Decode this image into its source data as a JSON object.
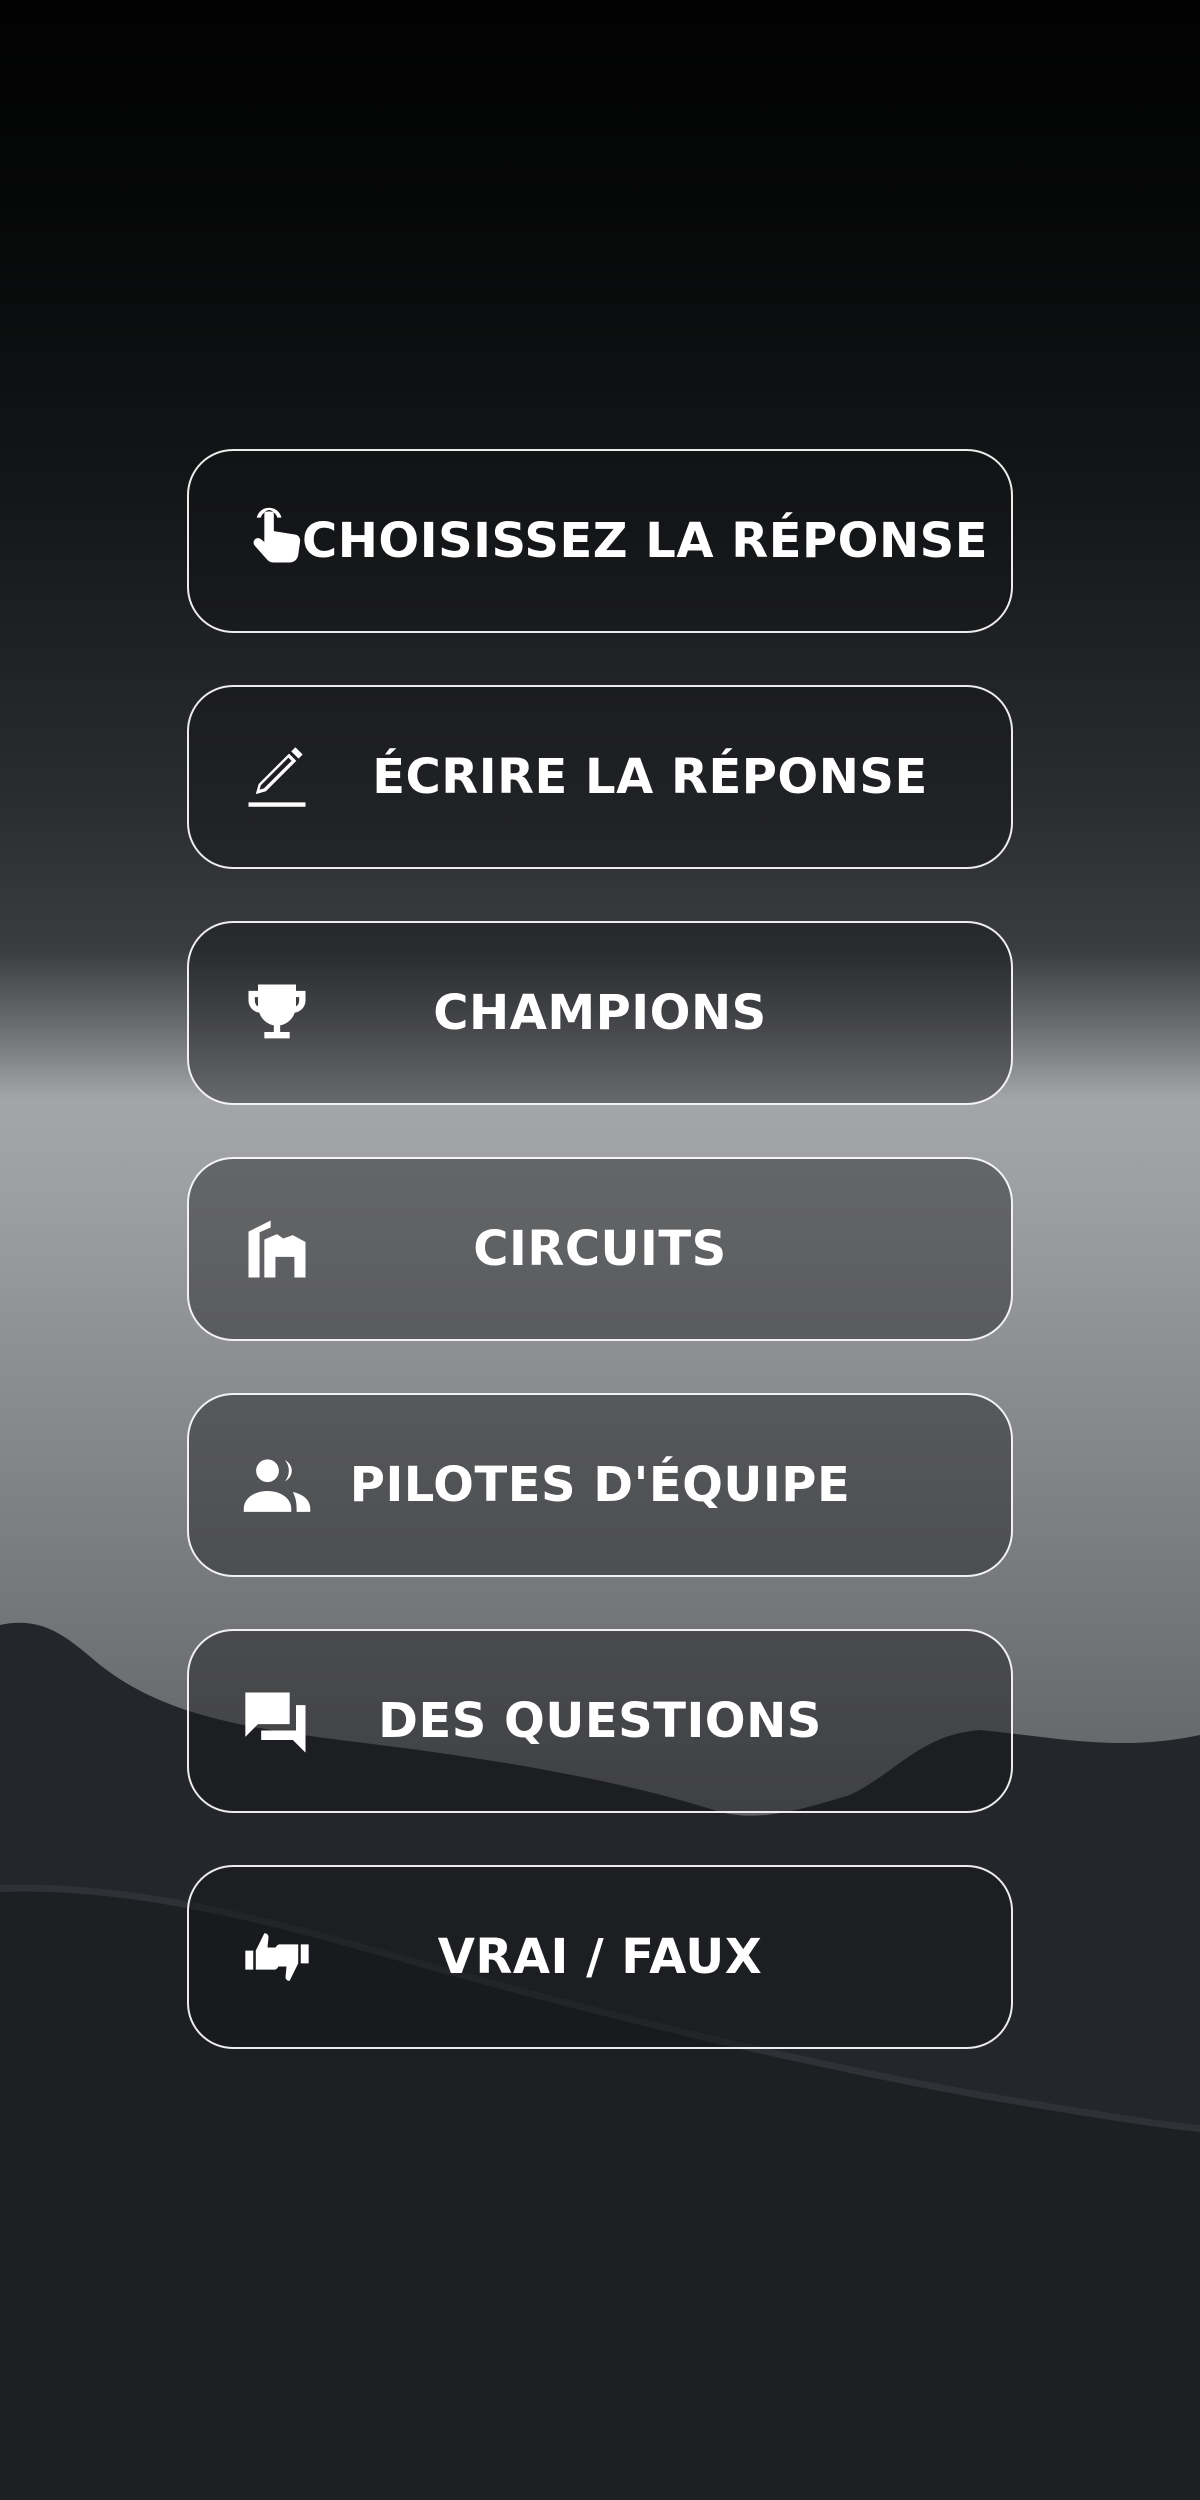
{
  "theme": {
    "background_top": "#030303",
    "background_mid": "#2a2c30",
    "background_glow": "#a9abad",
    "background_bottom": "#1d1f22",
    "button_border": "#ffffff",
    "text_color": "#ffffff"
  },
  "menu": {
    "buttons": [
      {
        "id": "choose",
        "label": "CHOISISSEZ LA RÉPONSE",
        "icon": "hand-pointer-icon"
      },
      {
        "id": "write",
        "label": "ÉCRIRE LA RÉPONSE",
        "icon": "pencil-icon"
      },
      {
        "id": "champions",
        "label": "CHAMPIONS",
        "icon": "trophy-icon"
      },
      {
        "id": "circuits",
        "label": "CIRCUITS",
        "icon": "stadium-icon"
      },
      {
        "id": "team-drivers",
        "label": "PILOTES D'ÉQUIPE",
        "icon": "people-icon"
      },
      {
        "id": "questions",
        "label": "DES QUESTIONS",
        "icon": "chat-bubbles-icon"
      },
      {
        "id": "true-false",
        "label": "VRAI / FAUX",
        "icon": "thumbs-up-down-icon"
      }
    ]
  }
}
